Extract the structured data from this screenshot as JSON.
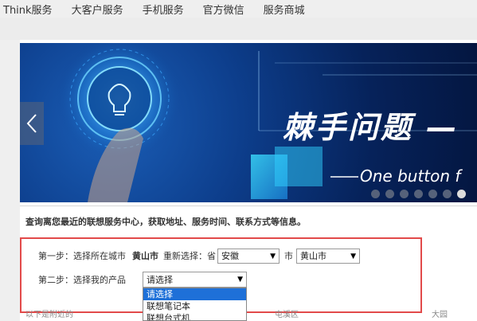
{
  "topnav": {
    "items": [
      "Think服务",
      "大客户服务",
      "手机服务",
      "官方微信",
      "服务商城"
    ]
  },
  "banner": {
    "headline": "棘手问题 —",
    "subline": "One button f",
    "dots_count": 7,
    "active_dot": 6
  },
  "info": {
    "text": "查询离您最近的联想服务中心，获取地址、服务时间、联系方式等信息。"
  },
  "step1": {
    "label": "第一步：选择所在城市",
    "city": "黄山市",
    "reselect": "重新选择：省",
    "province_value": "安徽",
    "city_label": "市",
    "city_value": "黄山市"
  },
  "step2": {
    "label": "第二步：选择我的产品",
    "product_value": "请选择",
    "options": [
      "请选择",
      "联想笔记本",
      "联想台式机"
    ]
  },
  "below": {
    "left": "以下是附近的",
    "mid": "屯溪区",
    "right": "大园"
  },
  "colors": {
    "highlight_border": "#e24a4a",
    "selected_option": "#1e70d8"
  }
}
